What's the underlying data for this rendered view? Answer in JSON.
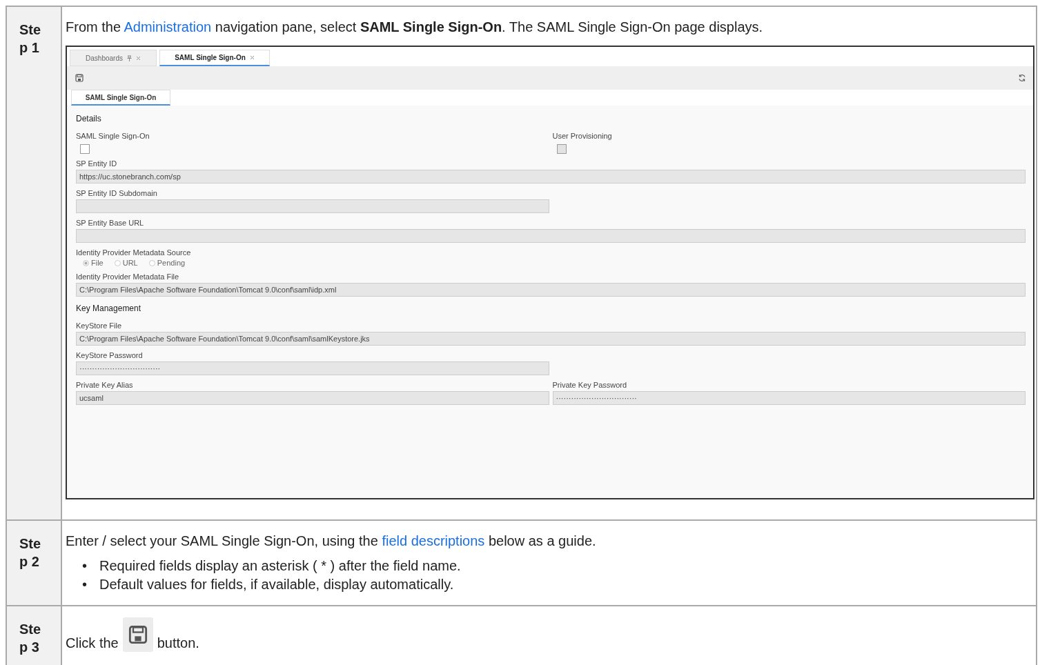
{
  "steps": [
    {
      "label": "Step 1",
      "kind": "screenshot",
      "text": [
        {
          "kind": "plain",
          "text": "From the "
        },
        {
          "kind": "link",
          "text": "Administration"
        },
        {
          "kind": "plain",
          "text": " navigation pane, select **SAML Single Sign-On**. The SAML Single Sign-On page displays."
        }
      ],
      "app": {
        "tabs": [
          {
            "label": "Dashboards",
            "pinned": true,
            "selected": false
          },
          {
            "label": "SAML Single Sign-On",
            "pinned": false,
            "selected": true
          }
        ],
        "subtabs": [
          {
            "label": "SAML Single Sign-On",
            "selected": true
          }
        ],
        "sections": [
          {
            "title": "Details",
            "rows": [
              [
                {
                  "kind": "checkbox",
                  "label": "SAML Single Sign-On",
                  "checked": false,
                  "disabled": false
                },
                {
                  "kind": "checkbox",
                  "label": "User Provisioning",
                  "checked": false,
                  "disabled": true
                }
              ],
              [
                {
                  "kind": "wide-text",
                  "label": "SP Entity ID",
                  "value": "https://uc.stonebranch.com/sp"
                }
              ],
              [
                {
                  "kind": "text",
                  "label": "SP Entity ID Subdomain"
                }
              ],
              [
                {
                  "kind": "wide-text",
                  "label": "SP Entity Base URL"
                }
              ],
              [
                {
                  "kind": "radio",
                  "label": "Identity Provider Metadata Source",
                  "options": [
                    {
                      "label": "File",
                      "selected": true
                    },
                    {
                      "label": "URL",
                      "selected": false
                    },
                    {
                      "label": "Pending",
                      "selected": false
                    }
                  ]
                }
              ],
              [
                {
                  "kind": "wide-text",
                  "label": "Identity Provider Metadata File",
                  "value": "C:\\Program Files\\Apache Software Foundation\\Tomcat 9.0\\conf\\saml\\idp.xml"
                }
              ]
            ]
          },
          {
            "title": "Key Management",
            "rows": [
              [
                {
                  "kind": "wide-text",
                  "label": "KeyStore File",
                  "value": "C:\\Program Files\\Apache Software Foundation\\Tomcat 9.0\\conf\\saml\\samlKeystore.jks"
                }
              ],
              [
                {
                  "kind": "text",
                  "label": "KeyStore Password",
                  "value": "································"
                }
              ],
              [
                {
                  "kind": "text",
                  "label": "Private Key Alias",
                  "value": "ucsaml"
                },
                {
                  "kind": "text",
                  "label": "Private Key Password",
                  "value": "································"
                }
              ]
            ]
          }
        ]
      }
    },
    {
      "label": "Step 2",
      "kind": "list",
      "text": [
        {
          "kind": "plain",
          "text": "Enter / select your SAML Single Sign-On, using the "
        },
        {
          "kind": "link",
          "text": "field descriptions"
        },
        {
          "kind": "plain",
          "text": " below as a guide."
        }
      ],
      "bullets": [
        {
          "marker": "•",
          "text": "Required fields display an asterisk ( * ) after the field name."
        },
        {
          "marker": "•",
          "text": "Default values for fields, if available, display automatically."
        }
      ]
    },
    {
      "label": "Step 3",
      "kind": "button",
      "text": [
        {
          "kind": "plain",
          "text": "Click the"
        },
        {
          "kind": "icon"
        },
        {
          "kind": "plain",
          "text": "button."
        }
      ]
    }
  ]
}
